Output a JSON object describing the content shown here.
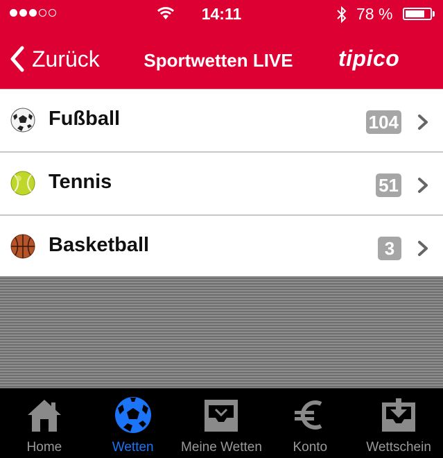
{
  "status_bar": {
    "time": "14:11",
    "battery_percent": "78 %",
    "battery_level": 0.78,
    "signal_bars_filled": 3,
    "signal_bars_total": 5
  },
  "nav": {
    "back_label": "Zurück",
    "title": "Sportwetten LIVE",
    "logo": "tipico"
  },
  "colors": {
    "brand": "#dd0033",
    "active_tab": "#1c74f6",
    "badge": "#a6a6a6"
  },
  "sports": [
    {
      "label": "Fußball",
      "count": "104",
      "icon": "soccer-ball-icon"
    },
    {
      "label": "Tennis",
      "count": "51",
      "icon": "tennis-ball-icon"
    },
    {
      "label": "Basketball",
      "count": "3",
      "icon": "basketball-icon"
    }
  ],
  "tabs": [
    {
      "label": "Home",
      "icon": "home-icon",
      "active": false
    },
    {
      "label": "Wetten",
      "icon": "soccer-ball-icon",
      "active": true
    },
    {
      "label": "Meine Wetten",
      "icon": "inbox-tray-icon",
      "active": false
    },
    {
      "label": "Konto",
      "icon": "euro-icon",
      "active": false
    },
    {
      "label": "Wettschein",
      "icon": "download-tray-icon",
      "active": false
    }
  ]
}
